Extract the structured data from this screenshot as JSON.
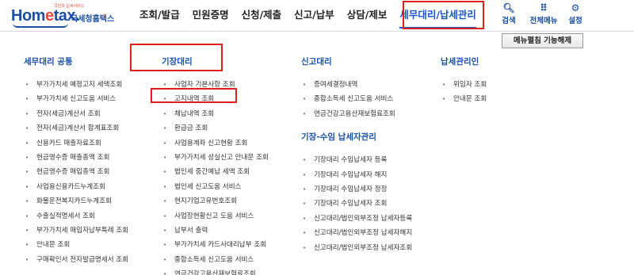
{
  "logo": {
    "tagline": "국민과 납세서비스",
    "brand_home": "Hom",
    "brand_e": "e",
    "brand_tax": "tax.",
    "agency": "국세청홈택스"
  },
  "nav": [
    {
      "label": "조회/발급"
    },
    {
      "label": "민원증명"
    },
    {
      "label": "신청/제출"
    },
    {
      "label": "신고/납부"
    },
    {
      "label": "상담/제보"
    },
    {
      "label": "세무대리/납세관리"
    }
  ],
  "utilities": [
    {
      "icon": "search-icon",
      "glyph": "🔍",
      "label": "검색"
    },
    {
      "icon": "grid-menu-icon",
      "glyph": "⠿",
      "label": "전체메뉴"
    },
    {
      "icon": "gear-icon",
      "glyph": "⚙",
      "label": "설정"
    }
  ],
  "menu_button": "메뉴펼침 기능해제",
  "columns": {
    "common": {
      "title": "세무대리 공통",
      "items": [
        "부가가치세 예정고지 세액조회",
        "부가가치세 신고도움 서비스",
        "전자(세금)계산서 조회",
        "전자(세금)계산서 합계표조회",
        "신용카드 매출자료조회",
        "현금영수증 매출총액 조회",
        "현금영수증 매입총액 조회",
        "사업용신용카드누계조회",
        "화물운전복지카드누계조회",
        "수출실적명세서 조회",
        "부가가치세 매입자납부특례 조회",
        "안내문 조회",
        "구매확인서 전자발급명세서 조회"
      ]
    },
    "bookkeeping": {
      "title": "기장대리",
      "items": [
        "사업자 기본사항 조회",
        "고지내역 조회",
        "체납내역 조회",
        "환급금 조회",
        "사업용계좌 신고현황 조회",
        "부가가치세 성실신고 안내문 조회",
        "법인세 중간예납 세액 조회",
        "법인세 신고도움 서비스",
        "현지기업고유번호조회",
        "사업장현황신고 도움 서비스",
        "납부서 출력",
        "부가가치세 카드사대리납부 조회",
        "종합소득세 신고도움 서비스",
        "연금건강고용산재보험료조회"
      ]
    },
    "filing": {
      "title": "신고대리",
      "items": [
        "증여세결정내역",
        "종합소득세 신고도움 서비스",
        "연금건강고용산재보험료조회"
      ],
      "subtitle": "기장-수임 납세자관리",
      "items2": [
        "기장대리 수임납세자 등록",
        "기장대리 수임납세자 해지",
        "기장대리 수임납세자 정정",
        "기장대리 수임납세자 조회",
        "신고대리/법인외부조정 납세자등록",
        "신고대리/법인외부조정 납세자해지",
        "신고대리/법인외부조정 납세자조회"
      ]
    },
    "taxpayer": {
      "title": "납세관리인",
      "items": [
        "위임자 조회",
        "안내문 조회"
      ]
    }
  }
}
